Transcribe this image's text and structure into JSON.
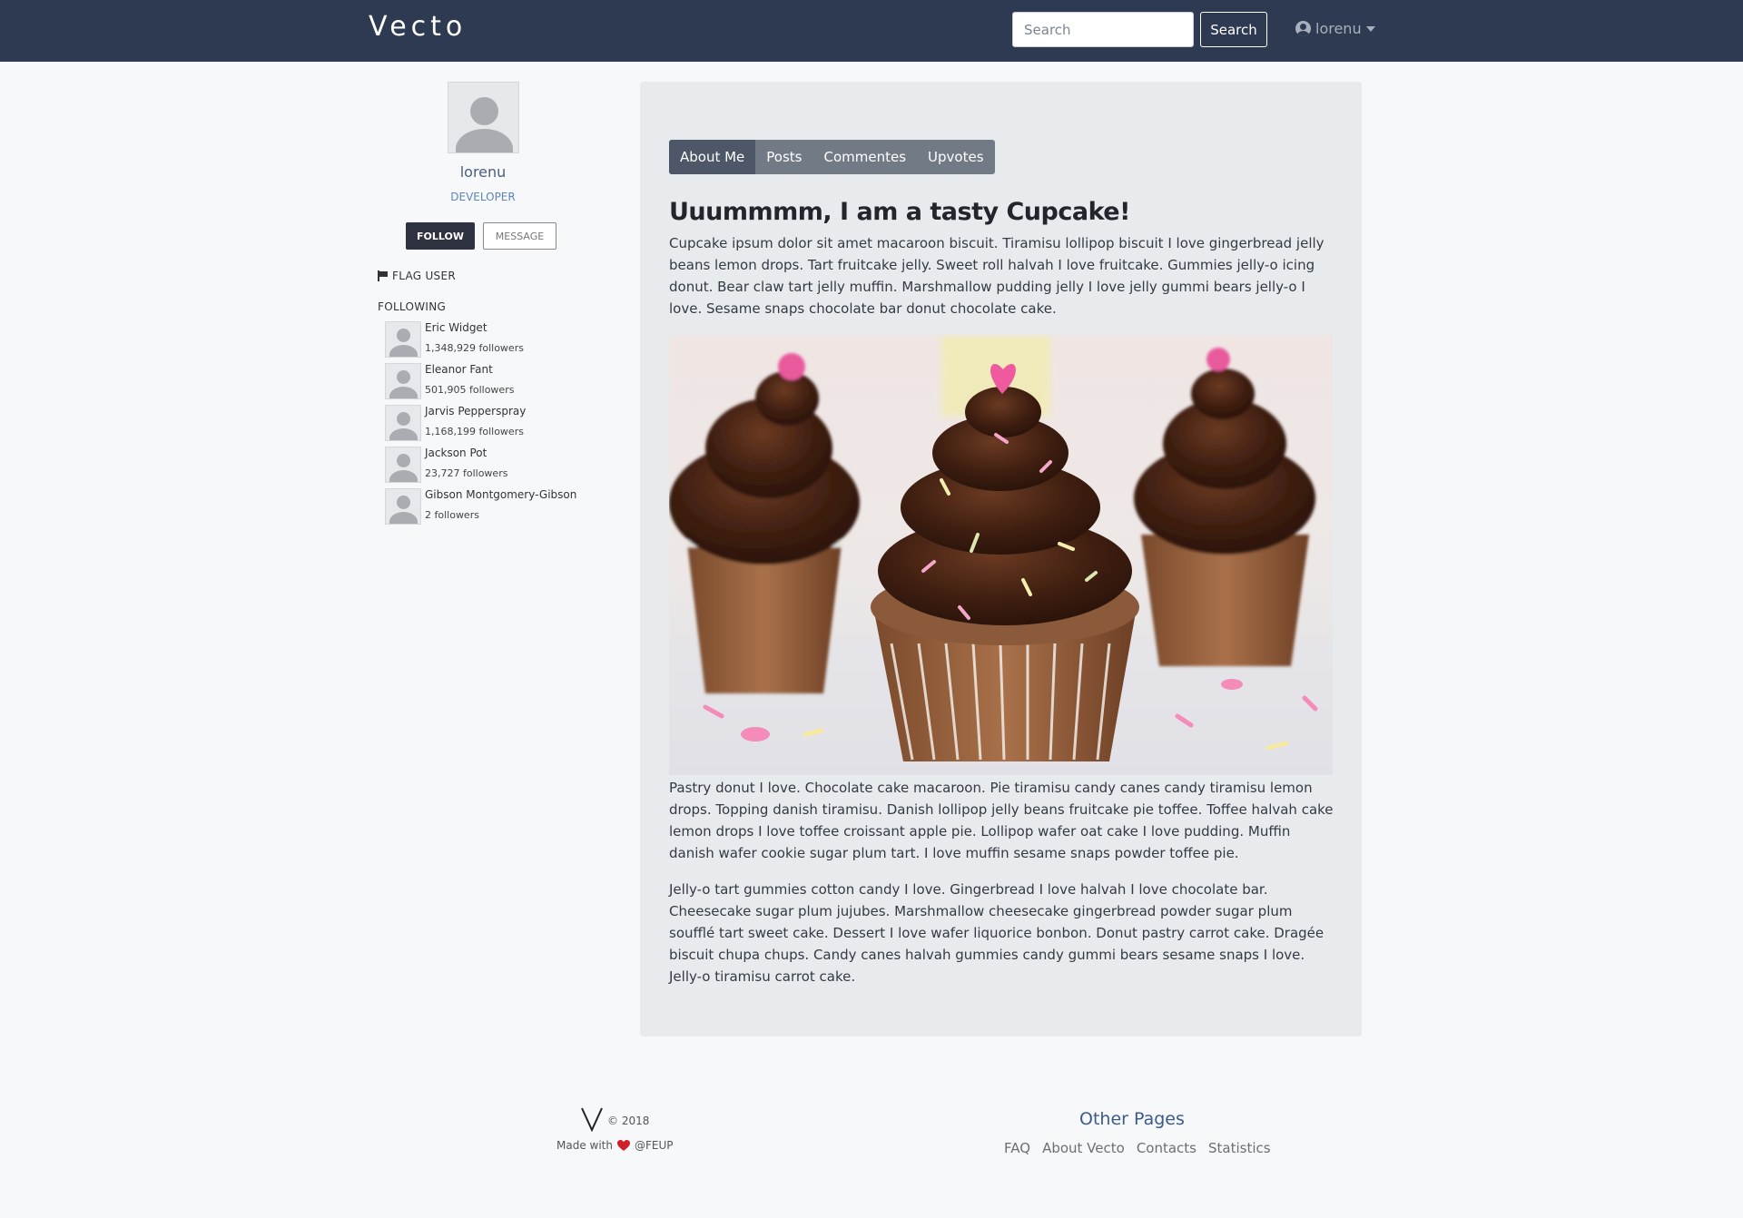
{
  "nav": {
    "brand": "Vecto",
    "search_placeholder": "Search",
    "search_button": "Search",
    "user_label": "lorenu"
  },
  "profile": {
    "username": "lorenu",
    "role": "DEVELOPER",
    "follow_button": "FOLLOW",
    "message_button": "MESSAGE",
    "flag_user": "FLAG USER",
    "following_title": "FOLLOWING",
    "following": [
      {
        "name": "Eric Widget",
        "followers": "1,348,929 followers"
      },
      {
        "name": "Eleanor Fant",
        "followers": "501,905 followers"
      },
      {
        "name": "Jarvis Pepperspray",
        "followers": "1,168,199 followers"
      },
      {
        "name": "Jackson Pot",
        "followers": "23,727 followers"
      },
      {
        "name": "Gibson Montgomery-Gibson",
        "followers": "2 followers"
      }
    ]
  },
  "tabs": [
    {
      "label": "About Me",
      "active": true
    },
    {
      "label": "Posts",
      "active": false
    },
    {
      "label": "Commentes",
      "active": false
    },
    {
      "label": "Upvotes",
      "active": false
    }
  ],
  "article": {
    "title": "Uuummmm, I am a tasty Cupcake!",
    "paragraph1": "Cupcake ipsum dolor sit amet macaroon biscuit. Tiramisu lollipop biscuit I love gingerbread jelly beans lemon drops. Tart fruitcake jelly. Sweet roll halvah I love fruitcake. Gummies jelly-o icing donut. Bear claw tart jelly muffin. Marshmallow pudding jelly I love jelly gummi bears jelly-o I love. Sesame snaps chocolate bar donut chocolate cake.",
    "paragraph2": "Pastry donut I love. Chocolate cake macaroon. Pie tiramisu candy canes candy tiramisu lemon drops. Topping danish tiramisu. Danish lollipop jelly beans fruitcake pie toffee. Toffee halvah cake lemon drops I love toffee croissant apple pie. Lollipop wafer oat cake I love pudding. Muffin danish wafer cookie sugar plum tart. I love muffin sesame snaps powder toffee pie.",
    "paragraph3": "Jelly-o tart gummies cotton candy I love. Gingerbread I love halvah I love chocolate bar. Cheesecake sugar plum jujubes. Marshmallow cheesecake gingerbread powder sugar plum soufflé tart sweet cake. Dessert I love wafer liquorice bonbon. Donut pastry carrot cake. Dragée biscuit chupa chups. Candy canes halvah gummies candy gummi bears sesame snaps I love. Jelly-o tiramisu carrot cake."
  },
  "footer": {
    "copyright": "© 2018",
    "made_with": "Made with",
    "made_at": "@FEUP",
    "other_pages_title": "Other Pages",
    "links": [
      "FAQ",
      "About Vecto",
      "Contacts",
      "Statistics"
    ]
  }
}
